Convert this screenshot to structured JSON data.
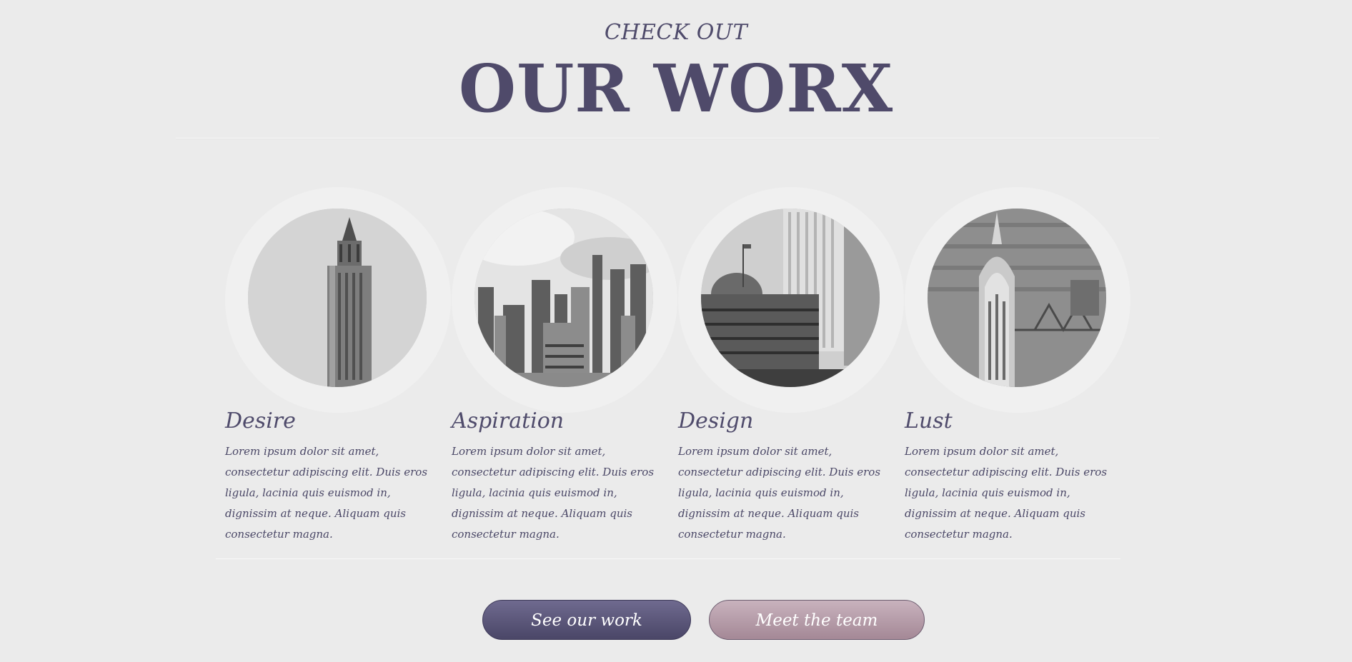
{
  "header": {
    "eyebrow": "CHECK OUT",
    "title": "OUR WORX"
  },
  "cards": [
    {
      "title": "Desire",
      "text": "Lorem ipsum dolor sit amet, consectetur adipiscing elit. Duis eros ligula, lacinia quis euismod in, dignissim at neque. Aliquam quis consectetur magna.",
      "image": "woolworth-building-photo"
    },
    {
      "title": "Aspiration",
      "text": "Lorem ipsum dolor sit amet, consectetur adipiscing elit. Duis eros ligula, lacinia quis euismod in, dignissim at neque. Aliquam quis consectetur magna.",
      "image": "skyline-photo"
    },
    {
      "title": "Design",
      "text": "Lorem ipsum dolor sit amet, consectetur adipiscing elit. Duis eros ligula, lacinia quis euismod in, dignissim at neque. Aliquam quis consectetur magna.",
      "image": "post-office-photo"
    },
    {
      "title": "Lust",
      "text": "Lorem ipsum dolor sit amet, consectetur adipiscing elit. Duis eros ligula, lacinia quis euismod in, dignissim at neque. Aliquam quis consectetur magna.",
      "image": "chrysler-building-photo"
    }
  ],
  "buttons": {
    "primary": "See our work",
    "secondary": "Meet the team"
  },
  "colors": {
    "background": "#ebebeb",
    "heading": "#4f4a6a",
    "primary_button": "#5b5679",
    "secondary_button": "#b89fab"
  }
}
